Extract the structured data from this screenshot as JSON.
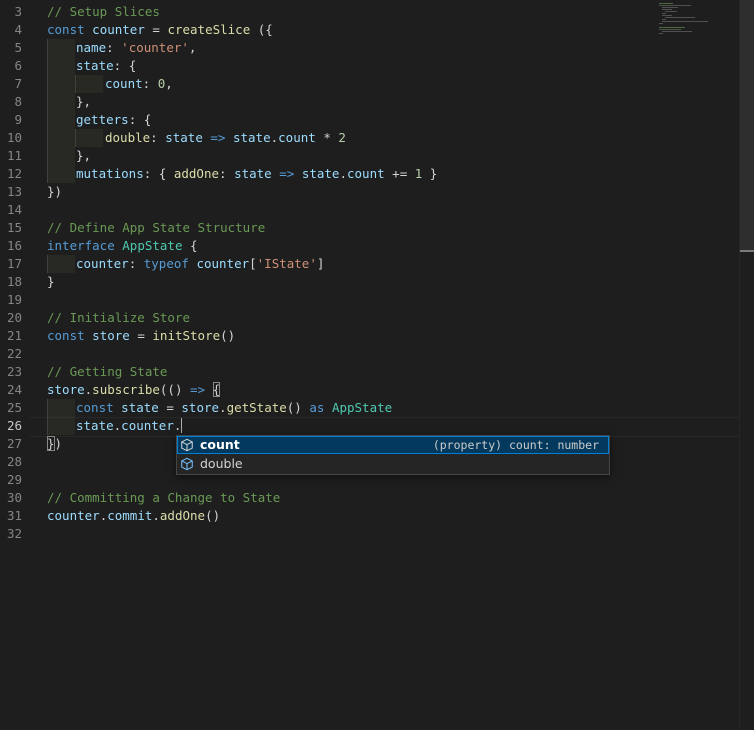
{
  "editor": {
    "line_numbers": [
      "3",
      "4",
      "5",
      "6",
      "7",
      "8",
      "9",
      "10",
      "11",
      "12",
      "13",
      "14",
      "15",
      "16",
      "17",
      "18",
      "19",
      "20",
      "21",
      "22",
      "23",
      "24",
      "25",
      "26",
      "27",
      "28",
      "29",
      "30",
      "31",
      "32"
    ],
    "active_line": "26",
    "lines": {
      "l3": "// Setup Slices",
      "l4_kw": "const",
      "l4_var": "counter",
      "l4_eq": " = ",
      "l4_fn": "createSlice",
      "l4_end": " ({",
      "l5_key": "name",
      "l5_str": "'counter'",
      "l6_key": "state",
      "l7_key": "count",
      "l7_num": "0",
      "l8": "},",
      "l9_key": "getters",
      "l10_key": "double",
      "l10_p": "state",
      "l10_arrow": "=>",
      "l10_obj": "state",
      "l10_prop": "count",
      "l10_num": "2",
      "l11": "},",
      "l12_key": "mutations",
      "l12_fn": "addOne",
      "l12_p": "state",
      "l12_arrow": "=>",
      "l12_obj": "state",
      "l12_prop": "count",
      "l12_num": "1",
      "l13": "})",
      "l15": "// Define App State Structure",
      "l16_kw": "interface",
      "l16_type": "AppState",
      "l17_key": "counter",
      "l17_kw": "typeof",
      "l17_var": "counter",
      "l17_str": "'IState'",
      "l18": "}",
      "l20": "// Initialize Store",
      "l21_kw": "const",
      "l21_var": "store",
      "l21_fn": "initStore",
      "l23": "// Getting State",
      "l24_var": "store",
      "l24_fn": "subscribe",
      "l24_arrow": "=>",
      "l25_kw": "const",
      "l25_var": "state",
      "l25_obj": "store",
      "l25_fn": "getState",
      "l25_as": "as",
      "l25_type": "AppState",
      "l26_obj": "state",
      "l26_prop": "counter",
      "l27": "})",
      "l30": "// Committing a Change to State",
      "l31_var": "counter",
      "l31_prop": "commit",
      "l31_fn": "addOne"
    }
  },
  "suggest": {
    "items": [
      {
        "label": "count",
        "detail": "(property) count: number",
        "icon": "property-cube-icon",
        "selected": true
      },
      {
        "label": "double",
        "detail": "",
        "icon": "property-cube-icon",
        "selected": false
      }
    ]
  },
  "colors": {
    "background": "#1e1e1e",
    "comment": "#6a9955",
    "keyword": "#569cd6",
    "function": "#dcdcaa",
    "variable": "#9cdcfe",
    "string": "#ce9178",
    "number": "#b5cea8",
    "type": "#4ec9b0",
    "selection": "#04395e",
    "focus_border": "#007fd4"
  }
}
